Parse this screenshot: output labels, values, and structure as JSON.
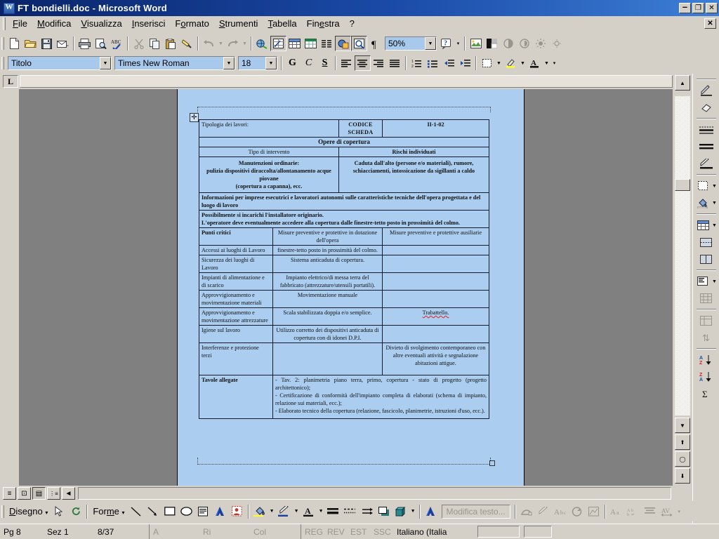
{
  "window": {
    "title": "FT bondielli.doc - Microsoft Word",
    "icon": "word-document-icon",
    "minimize": "–",
    "restore": "❐",
    "close": "✕",
    "document_close": "✕"
  },
  "menubar": {
    "items": [
      {
        "label": "File",
        "accel": "F"
      },
      {
        "label": "Modifica",
        "accel": "M"
      },
      {
        "label": "Visualizza",
        "accel": "V"
      },
      {
        "label": "Inserisci",
        "accel": "I"
      },
      {
        "label": "Formato",
        "accel": "o"
      },
      {
        "label": "Strumenti",
        "accel": "S"
      },
      {
        "label": "Tabella",
        "accel": "T"
      },
      {
        "label": "Finestra",
        "accel": "e"
      },
      {
        "label": "?",
        "accel": ""
      }
    ]
  },
  "toolbar_standard": {
    "buttons": [
      "new-document-icon",
      "open-folder-icon",
      "save-icon",
      "email-icon",
      "print-icon",
      "print-preview-icon",
      "spellcheck-icon",
      "cut-scissors-icon",
      "copy-icon",
      "paste-icon",
      "format-painter-icon",
      "undo-icon",
      "redo-icon",
      "insert-hyperlink-icon",
      "tables-and-borders-icon",
      "insert-table-icon",
      "insert-excel-sheet-icon",
      "columns-icon",
      "drawing-icon",
      "document-map-icon",
      "show-formatting-marks-icon"
    ],
    "zoom_value": "50%",
    "help_icon": "help-icon"
  },
  "toolbar_picture": {
    "buttons": [
      "insert-picture-icon",
      "image-control-icon",
      "more-contrast-icon",
      "less-contrast-icon",
      "more-brightness-icon",
      "less-brightness-icon",
      "crop-icon",
      "line-style-icon",
      "text-wrapping-icon",
      "format-picture-icon",
      "set-transparent-color-icon",
      "reset-picture-icon"
    ]
  },
  "toolbar_formatting": {
    "style": "Titolo",
    "font": "Times New Roman",
    "size": "18",
    "bold_label": "G",
    "italic_label": "C",
    "underline_label": "S",
    "buttons": [
      "align-left-icon",
      "align-center-icon",
      "align-right-icon",
      "justify-icon",
      "numbered-list-icon",
      "bulleted-list-icon",
      "decrease-indent-icon",
      "increase-indent-icon",
      "borders-icon",
      "highlight-icon",
      "font-color-icon"
    ]
  },
  "ruler": {
    "tab_selector": "L"
  },
  "tables_borders_toolbar": {
    "buttons": [
      "draw-table-pencil-icon",
      "eraser-icon",
      "line-style-icon",
      "line-weight-icon",
      "border-color-pencil-icon",
      "outside-border-icon",
      "shading-color-icon",
      "insert-table-icon",
      "merge-cells-icon",
      "split-cells-icon",
      "align-top-left-icon",
      "distribute-rows-evenly-icon",
      "distribute-columns-evenly-icon",
      "table-autoformat-icon",
      "change-text-direction-icon",
      "sort-ascending-icon",
      "sort-descending-icon",
      "autosum-icon"
    ]
  },
  "view_bar": {
    "buttons": [
      {
        "name": "normal-view-button",
        "glyph": "≡",
        "active": false
      },
      {
        "name": "web-layout-view-button",
        "glyph": "⊡",
        "active": false
      },
      {
        "name": "print-layout-view-button",
        "glyph": "▤",
        "active": true
      },
      {
        "name": "outline-view-button",
        "glyph": "⋮≡",
        "active": false
      }
    ],
    "scroll_left_glyph": "◄"
  },
  "scrollbar": {
    "up_glyph": "▲",
    "down_glyph": "▼",
    "prev_page_glyph": "⬆",
    "select_browse_object_glyph": "◯",
    "next_page_glyph": "⬇"
  },
  "drawing_toolbar": {
    "menu_disegno": "Disegno",
    "menu_forme": "Forme",
    "edit_text_button": "Modifica testo...",
    "buttons": [
      "select-objects-arrow-icon",
      "free-rotate-icon",
      "line-icon",
      "arrow-icon",
      "rectangle-icon",
      "oval-icon",
      "text-box-icon",
      "wordart-icon",
      "clip-art-icon",
      "fill-color-icon",
      "line-color-icon",
      "font-color-icon",
      "line-style-icon",
      "dash-style-icon",
      "arrow-style-icon",
      "shadow-icon",
      "3d-icon",
      "wordart-gallery-icon",
      "wordart-same-letter-heights-icon",
      "wordart-vertical-text-icon",
      "wordart-alignment-icon",
      "wordart-character-spacing-icon"
    ]
  },
  "statusbar": {
    "page": "Pg 8",
    "section": "Sez 1",
    "page_of": "8/37",
    "at": "A",
    "line": "Ri",
    "col": "Col",
    "rec": "REG",
    "trk": "REV",
    "ext": "EST",
    "ovr": "SSC",
    "language": "Italiano (Italia"
  },
  "document": {
    "table": {
      "row_tipologia_label": "Tipologia dei lavori:",
      "codice_scheda_label": "CODICE SCHEDA",
      "codice_scheda_value": "II-1-02",
      "opere_di_copertura": "Opere di copertura",
      "tipo_di_intervento": "Tipo di intervento",
      "rischi_individuati": "Rischi individuati",
      "manutenzioni_line1": "Manutenzioni ordinarie:",
      "manutenzioni_line2": "pulizia dispositivi diraccolta/allontanamento acque piovane",
      "manutenzioni_line3": "(copertura a capanna), ecc.",
      "rischi_text": "Caduta dall'alto (persone e/o materiali), rumore, schiacciamenti, intossicazione da sigillanti a caldo",
      "informazioni_text": "Informazioni per imprese esecutrici e lavoratori autonomi sulle caratteristiche tecniche dell'opera progettata e del luogo di lavoro",
      "possibilmente_line1": "Possibilmente si incarichi l'installatore originario.",
      "possibilmente_line2": "L'operatore deve eventualmente accedere alla copertura dalle finestre-tetto posto in prossimità del colmo.",
      "head_punti_critici": "Punti critici",
      "head_misure_dotazione": "Misure preventive e protettive in dotazione dell'opera",
      "head_misure_ausiliarie": "Misure preventive e protettive ausiliarie",
      "rows": [
        {
          "punto": "Accessi ai luoghi di Lavoro",
          "dotazione": "finestre-tetto posto in prossimità del colmo.",
          "ausiliarie": ""
        },
        {
          "punto": "Sicurezza dei luoghi di Lavoro",
          "dotazione": "Sistema anticaduta di copertura.",
          "ausiliarie": ""
        },
        {
          "punto": "Impianti di alimentazione e di scarico",
          "dotazione": "Impianto elettrico/di messa terra del fabbricato (attrezzature/utensili portatili).",
          "ausiliarie": ""
        },
        {
          "punto": "Approvvigionamento e movimentazione materiali",
          "dotazione": "Movimentazione manuale",
          "ausiliarie": ""
        },
        {
          "punto": "Approvvigionamento e movimentazione attrezzature",
          "dotazione": "Scala stabilizzata doppia e/o semplice.",
          "ausiliarie": "Trabattello.",
          "ausiliarie_misspelled": true
        },
        {
          "punto": "Igiene sul lavoro",
          "dotazione": "Utilizzo corretto dei dispositivi anticaduta di copertura con di idonei D.P.I.",
          "ausiliarie": ""
        },
        {
          "punto": "Interferenze e protezione terzi",
          "dotazione": "",
          "ausiliarie": "Divieto di svolgimento contemporaneo con altre eventuali attività e segnalazione abitazioni attigue."
        }
      ],
      "tavole_label": "Tavole allegate",
      "tavole_items": [
        "-  Tav. 2: planimetria piano terra, primo, copertura - stato di progetto (progetto architettonico);",
        "- Certificazione di conformità dell'impianto completa di elaborati (schema di impianto, relazione sui materiali, ecc.);",
        "- Elaborato tecnico della copertura (relazione, fascicolo, planimetrie, istruzioni d'uso, ecc.)."
      ]
    }
  }
}
